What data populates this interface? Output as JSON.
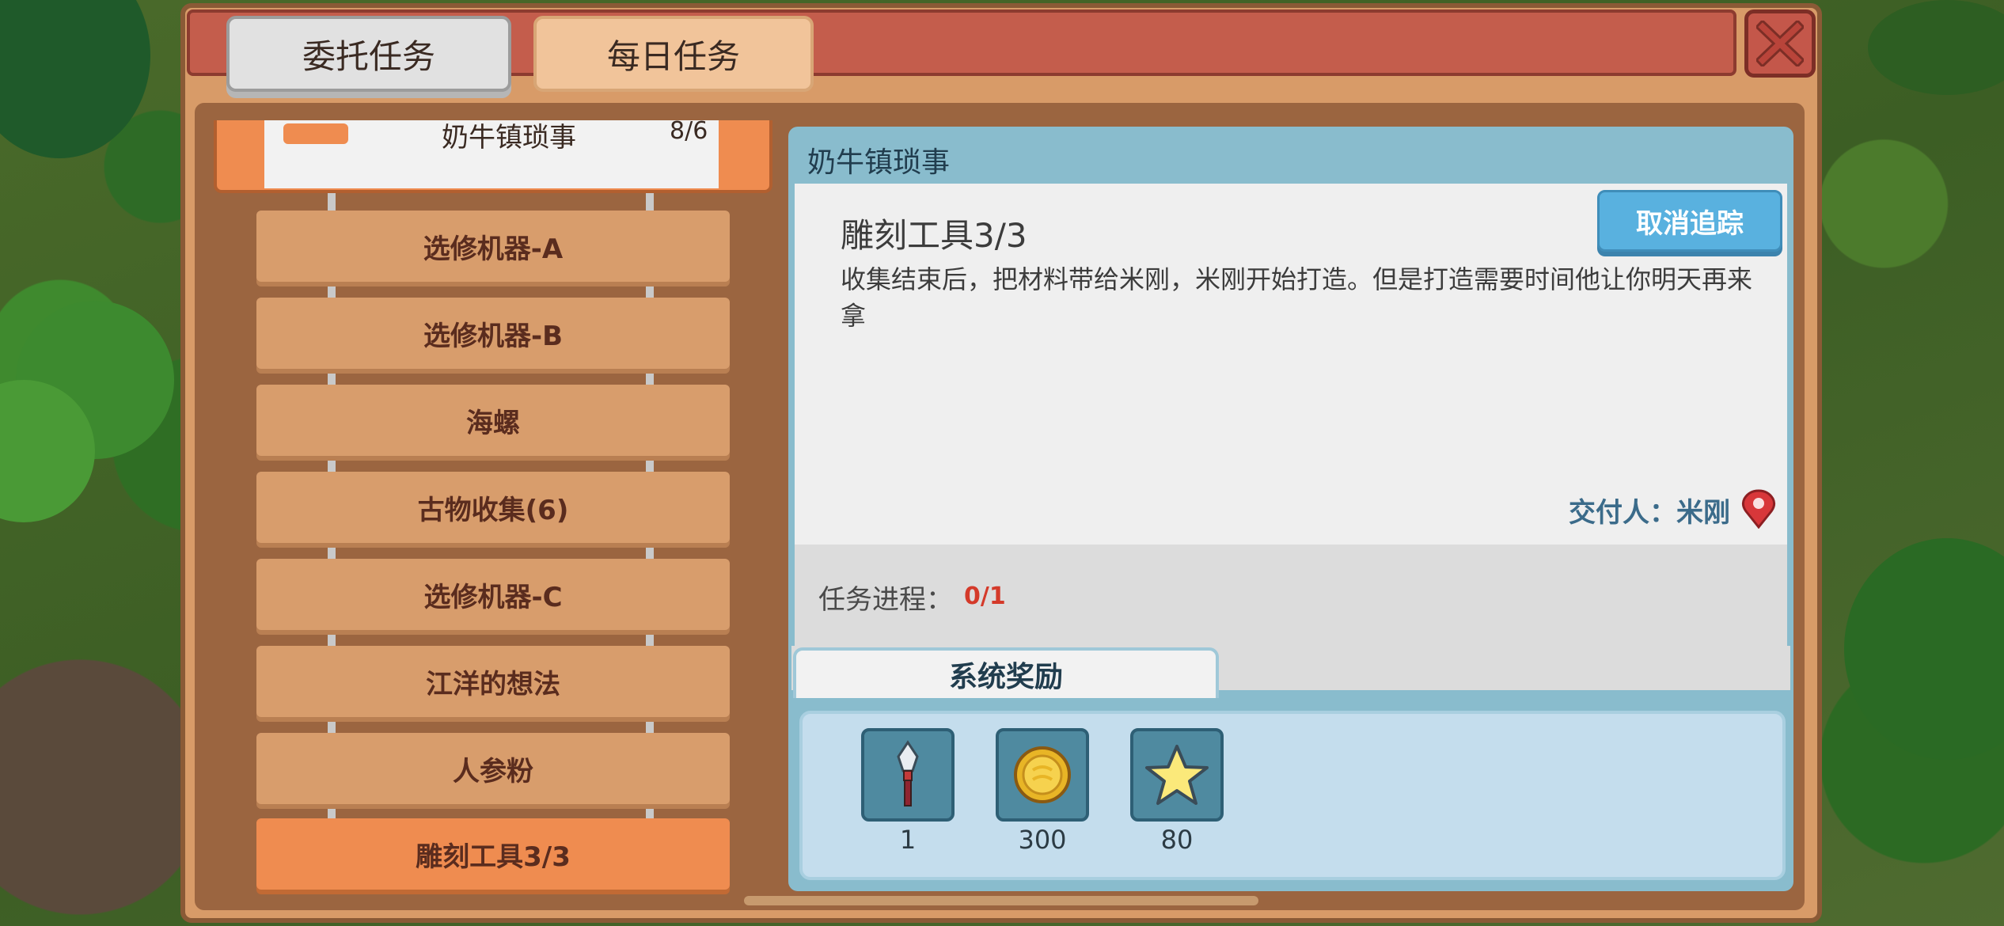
{
  "tabs": {
    "commission": "委托任务",
    "daily": "每日任务"
  },
  "quest_list": {
    "header": {
      "title": "奶牛镇琐事",
      "count": "8/6"
    },
    "items": [
      {
        "label": "选修机器-A"
      },
      {
        "label": "选修机器-B"
      },
      {
        "label": "海螺"
      },
      {
        "label": "古物收集(6)"
      },
      {
        "label": "选修机器-C"
      },
      {
        "label": "江洋的想法"
      },
      {
        "label": "人参粉"
      },
      {
        "label": "雕刻工具3/3"
      }
    ],
    "active_index": 7
  },
  "detail": {
    "category": "奶牛镇琐事",
    "task_name": "雕刻工具3/3",
    "description": "收集结束后，把材料带给米刚，米刚开始打造。但是打造需要时间他让你明天再来拿",
    "untrack_label": "取消追踪",
    "giver": "交付人：米刚",
    "progress_label": "任务进程：",
    "progress_value": "0/1"
  },
  "rewards": {
    "tab_label": "系统奖励",
    "items": [
      {
        "icon": "carving-tool-icon",
        "qty": "1"
      },
      {
        "icon": "gold-coin-icon",
        "qty": "300"
      },
      {
        "icon": "star-icon",
        "qty": "80"
      }
    ]
  },
  "colors": {
    "panel": "#d89b68",
    "active_item": "#ef8c50",
    "accent_button": "#59b1df",
    "progress_red": "#d43a2a"
  }
}
